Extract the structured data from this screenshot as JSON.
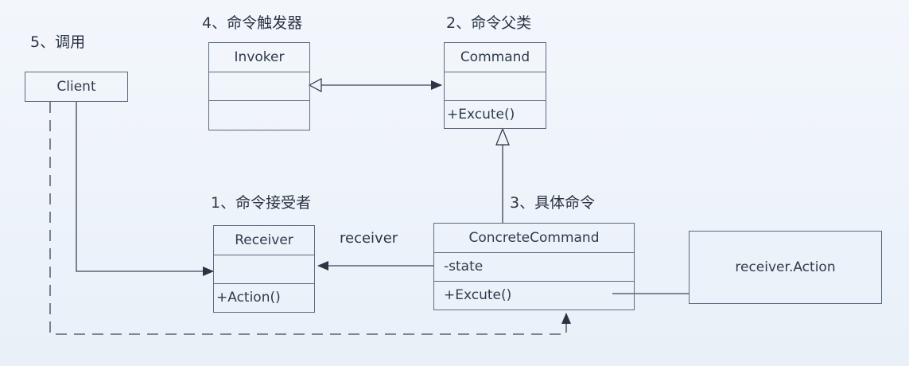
{
  "labels": {
    "client_role": "5、调用",
    "invoker_role": "4、命令触发器",
    "command_role": "2、命令父类",
    "receiver_role": "1、命令接受者",
    "concrete_role": "3、具体命令",
    "receiver_assoc": "receiver"
  },
  "classes": {
    "client": {
      "name": "Client"
    },
    "invoker": {
      "name": "Invoker"
    },
    "command": {
      "name": "Command",
      "method": "+Excute()"
    },
    "receiver": {
      "name": "Receiver",
      "method": "+Action()"
    },
    "concrete": {
      "name": "ConcreteCommand",
      "attribute": "-state",
      "method": "+Excute()"
    }
  },
  "note": {
    "text": "receiver.Action"
  },
  "colors": {
    "line": "#3b4658",
    "border": "#5b6c80",
    "text": "#2f3b4c",
    "background": "#eef3f9"
  }
}
